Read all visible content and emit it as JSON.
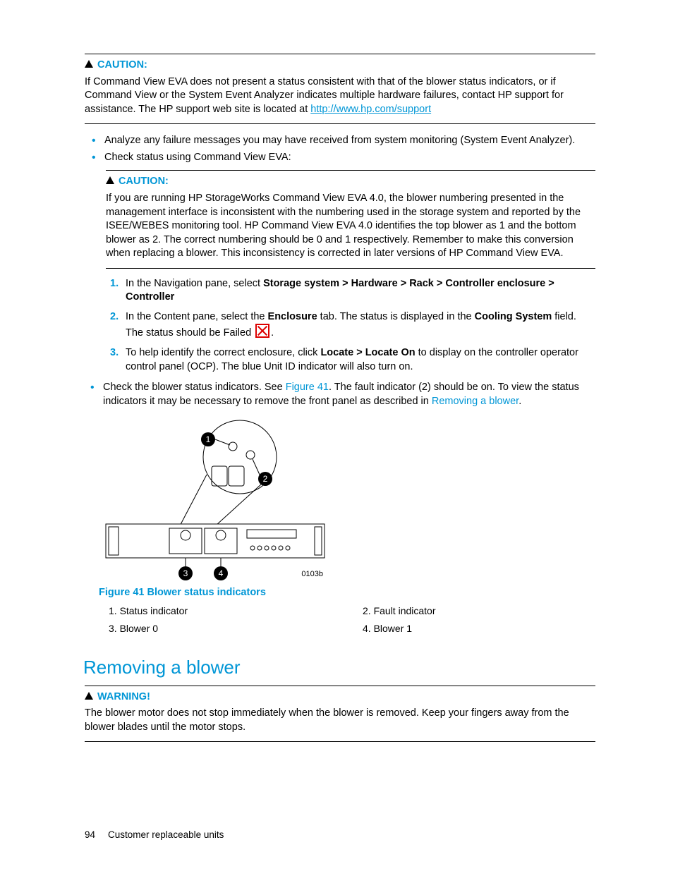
{
  "caution1": {
    "label": "CAUTION:",
    "text_a": "If Command View EVA does not present a status consistent with that of the blower status indicators, or if Command View or the System Event Analyzer indicates multiple hardware failures, contact HP support for assistance. The HP support web site is located at ",
    "link_text": "http://www.hp.com/support"
  },
  "bullets1": {
    "b1": "Analyze any failure messages you may have received from system monitoring (System Event Analyzer).",
    "b2": "Check status using Command View EVA:"
  },
  "caution2": {
    "label": "CAUTION:",
    "text": "If you are running HP StorageWorks Command View EVA 4.0, the blower numbering presented in the management interface is inconsistent with the numbering used in the storage system and reported by the ISEE/WEBES monitoring tool. HP Command View EVA 4.0 identifies the top blower as 1 and the bottom blower as 2. The correct numbering should be 0 and 1 respectively. Remember to make this conversion when replacing a blower. This inconsistency is corrected in later versions of HP Command View EVA."
  },
  "steps": {
    "n1": "1.",
    "n2": "2.",
    "n3": "3.",
    "s1a": "In the Navigation pane, select ",
    "s1b": "Storage system > Hardware > Rack > Controller enclosure > Controller",
    "s2a": "In the Content pane, select the ",
    "s2b": "Enclosure",
    "s2c": " tab. The status is displayed in the ",
    "s2d": "Cooling System",
    "s2e": " field. The status should be Failed ",
    "s2f": ".",
    "s3a": "To help identify the correct enclosure, click ",
    "s3b": "Locate > Locate On",
    "s3c": " to display on the controller operator control panel (OCP). The blue Unit ID indicator will also turn on."
  },
  "bullet_check": {
    "a": "Check the blower status indicators. See ",
    "ref1": "Figure 41",
    "b": ". The fault indicator (2) should be on. To view the status indicators it may be necessary to remove the front panel as described in ",
    "ref2": "Removing a blower",
    "c": "."
  },
  "figure": {
    "id_label": "0103b",
    "caption": "Figure 41 Blower status indicators",
    "leg1": "1. Status indicator",
    "leg2": "2. Fault indicator",
    "leg3": "3. Blower 0",
    "leg4": "4. Blower 1",
    "c1": "1",
    "c2": "2",
    "c3": "3",
    "c4": "4"
  },
  "section_heading": "Removing a blower",
  "warning": {
    "label": "WARNING!",
    "text": "The blower motor does not stop immediately when the blower is removed. Keep your fingers away from the blower blades until the motor stops."
  },
  "footer": {
    "page": "94",
    "chapter": "Customer replaceable units"
  }
}
